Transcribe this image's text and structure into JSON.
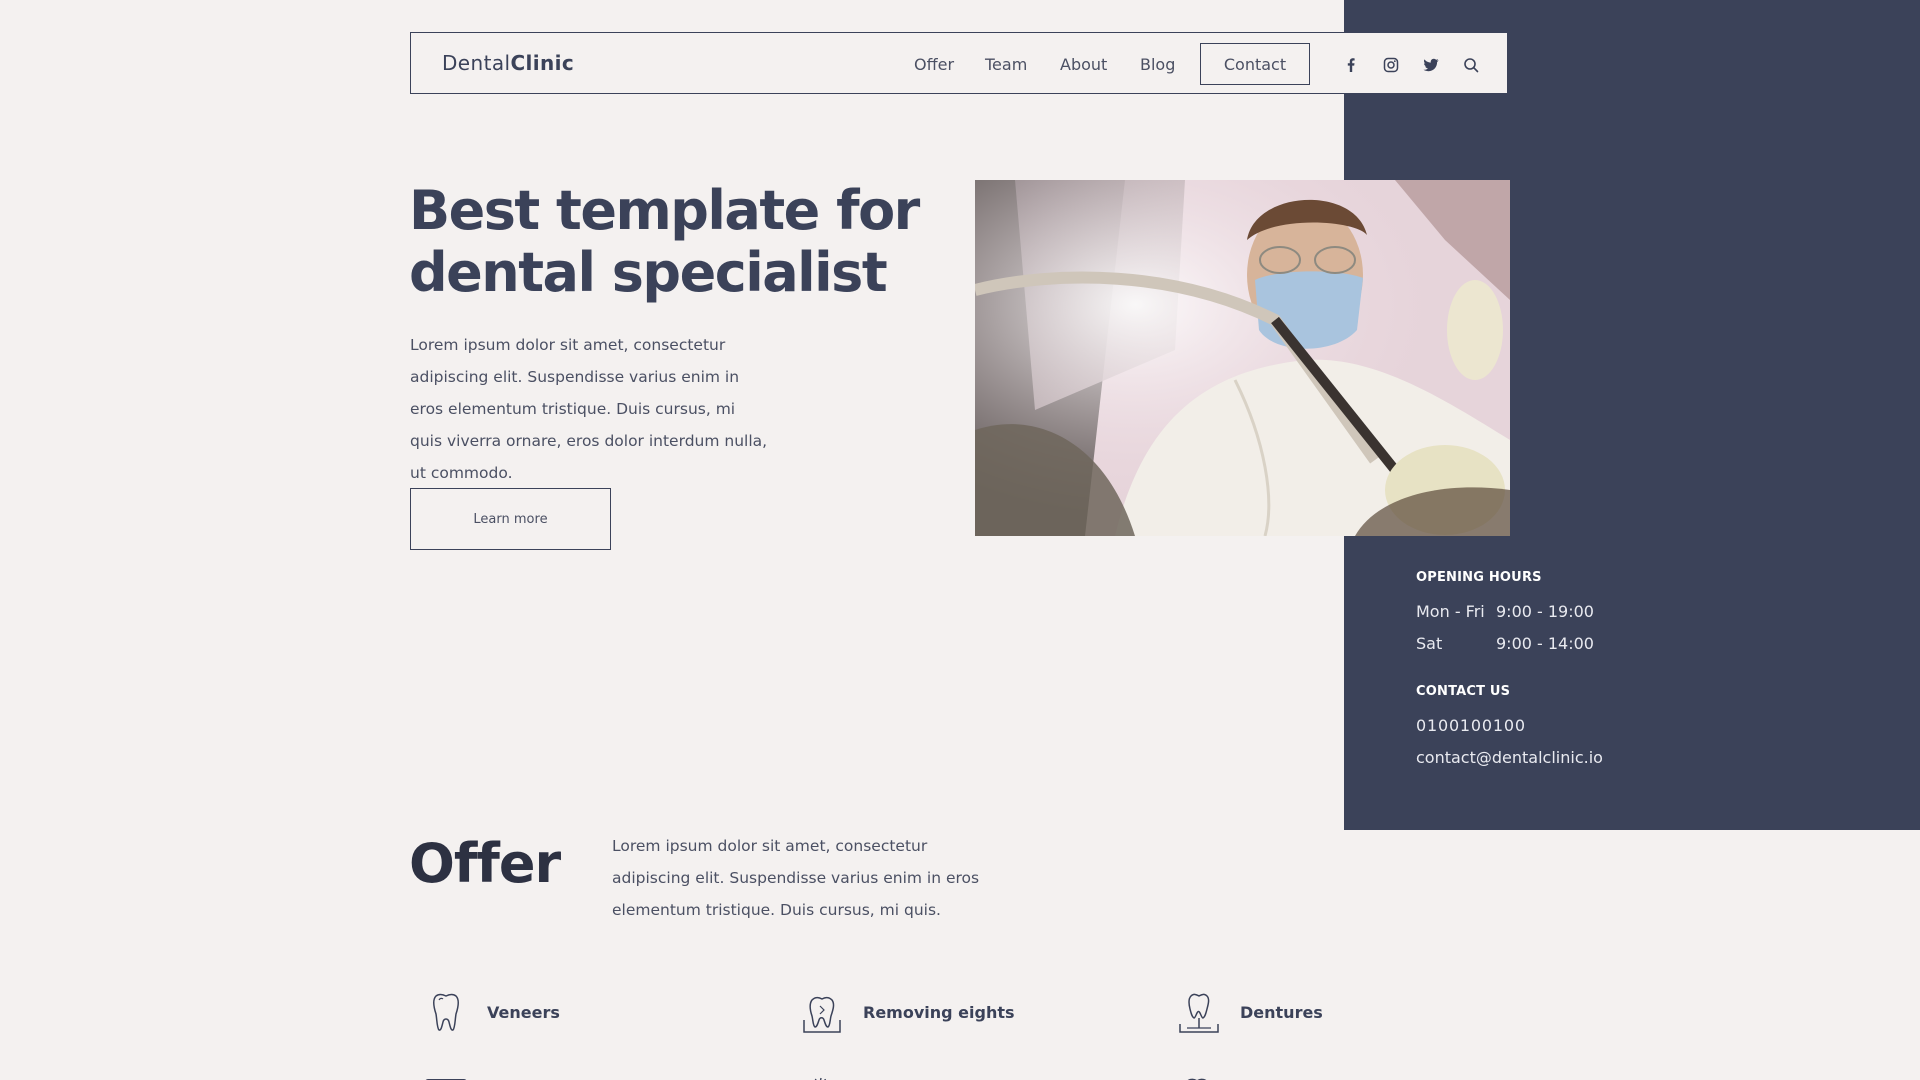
{
  "brand": {
    "prefix": "Dental",
    "suffix": "Clinic"
  },
  "nav": {
    "links": [
      "Offer",
      "Team",
      "About",
      "Blog"
    ],
    "contact_label": "Contact",
    "social_icons": [
      "facebook-icon",
      "instagram-icon",
      "twitter-icon",
      "search-icon"
    ]
  },
  "hero": {
    "title_line1": "Best template for",
    "title_line2": "dental specialist",
    "text": "Lorem ipsum dolor sit amet, consectetur adipiscing elit. Suspendisse varius enim in eros elementum tristique. Duis cursus, mi quis viverra ornare, eros dolor interdum nulla, ut commodo.",
    "button_label": "Learn more"
  },
  "opening_hours": {
    "heading": "OPENING HOURS",
    "rows": [
      {
        "day": "Mon - Fri",
        "hours": "9:00 - 19:00"
      },
      {
        "day": "Sat",
        "hours": "9:00 - 14:00"
      }
    ]
  },
  "contact": {
    "heading": "CONTACT US",
    "phone": "0100100100",
    "email": "contact@dentalclinic.io"
  },
  "offer": {
    "title": "Offer",
    "text": "Lorem ipsum dolor sit amet, consectetur adipiscing elit. Suspendisse varius enim in eros elementum tristique. Duis cursus, mi quis.",
    "services": [
      {
        "label": "Veneers",
        "icon": "tooth-icon"
      },
      {
        "label": "Removing eights",
        "icon": "tooth-removal-icon"
      },
      {
        "label": "Dentures",
        "icon": "denture-icon"
      }
    ]
  },
  "colors": {
    "dark_panel": "#3b4259",
    "background": "#f4f1f0",
    "text": "#4b5063"
  }
}
